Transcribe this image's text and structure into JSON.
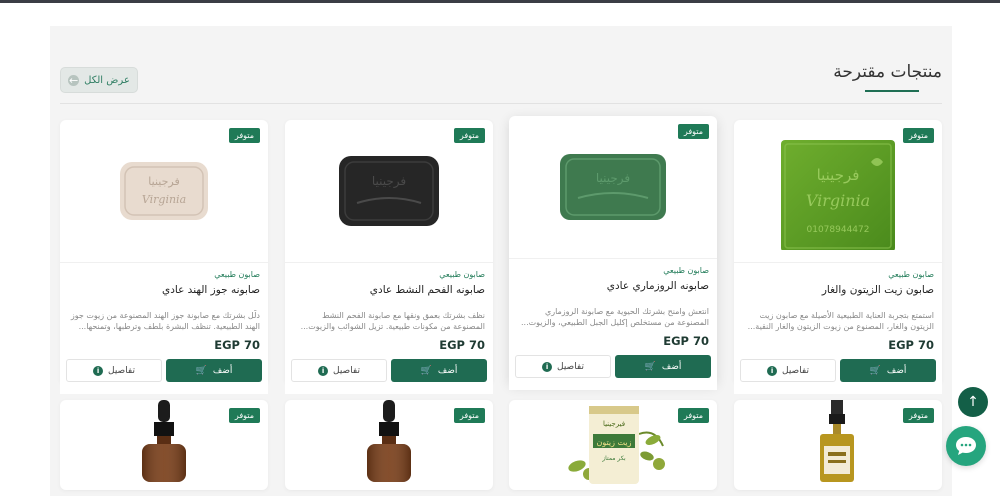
{
  "section": {
    "title": "منتجات مقترحة",
    "view_all_label": "عرض الكل"
  },
  "products": [
    {
      "badge": "متوفر",
      "category": "صابون طبيعي",
      "name": "صابون زيت الزيتون والغار",
      "description": "استمتع بتجربة العناية الطبيعية الأصيلة مع صابون زيت الزيتون والغار، المصنوع من زيوت الزيتون والغار النقية...",
      "price": "EGP 70",
      "add_label": "أضف",
      "details_label": "تفاصيل",
      "soap_brand": "فرجينيا",
      "soap_brand_latin": "Virginia",
      "soap_number": "01078944472"
    },
    {
      "badge": "متوفر",
      "category": "صابون طبيعي",
      "name": "صابونه الروزماري عادي",
      "description": "انتعش وامنح بشرتك الحيوية مع صابونة الروزماري المصنوعة من مستخلص إكليل الجبل الطبيعي، والزيوت...",
      "price": "EGP 70",
      "add_label": "أضف",
      "details_label": "تفاصيل",
      "soap_brand": "فرجينيا"
    },
    {
      "badge": "متوفر",
      "category": "صابون طبيعي",
      "name": "صابونه الفحم النشط عادي",
      "description": "نظف بشرتك بعمق ونقها مع صابونة الفحم النشط المصنوعة من مكونات طبيعية. تزيل الشوائب والزيوت...",
      "price": "EGP 70",
      "add_label": "أضف",
      "details_label": "تفاصيل",
      "soap_brand": "فرجينيا"
    },
    {
      "badge": "متوفر",
      "category": "صابون طبيعي",
      "name": "صابونه جوز الهند عادي",
      "description": "دلّل بشرتك مع صابونة جوز الهند المصنوعة من زيوت جوز الهند الطبيعية. تنظف البشرة بلطف وترطبها، وتمنحها...",
      "price": "EGP 70",
      "add_label": "أضف",
      "details_label": "تفاصيل",
      "soap_brand": "فرجينيا",
      "soap_brand_latin": "Virginia"
    }
  ],
  "bottom_row": [
    {
      "badge": "متوفر"
    },
    {
      "badge": "متوفر",
      "jar_top": "فيرجينيا",
      "jar_label": "زيت زيتون",
      "jar_sub": "بكر ممتاز"
    },
    {
      "badge": "متوفر"
    },
    {
      "badge": "متوفر"
    }
  ],
  "colors": {
    "brand_green": "#1f6b52",
    "badge_green": "#1f7a57",
    "chat_green": "#26a57e"
  }
}
